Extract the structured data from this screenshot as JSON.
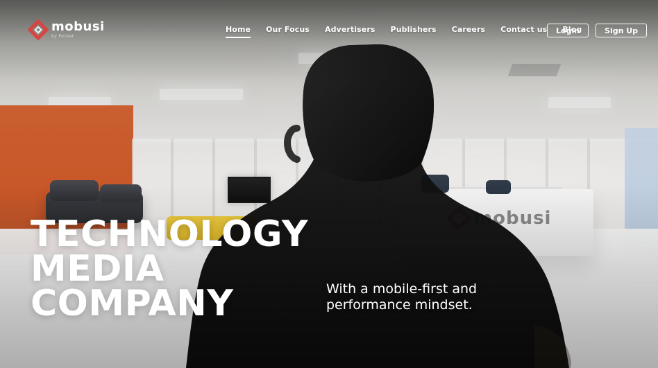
{
  "brand": {
    "name": "mobusi",
    "tagline": "by Pocket"
  },
  "nav": {
    "items": [
      {
        "label": "Home",
        "active": true
      },
      {
        "label": "Our Focus"
      },
      {
        "label": "Advertisers"
      },
      {
        "label": "Publishers"
      },
      {
        "label": "Careers"
      },
      {
        "label": "Contact us"
      },
      {
        "label": "Blog"
      }
    ]
  },
  "auth": {
    "login": "Login",
    "signup": "Sign Up"
  },
  "hero": {
    "headline": [
      "TECHNOLOGY",
      "MEDIA",
      "COMPANY"
    ],
    "subhead": "With a mobile-first and performance mindset.",
    "desk_logo_text": "mobusi"
  },
  "colors": {
    "accent": "#d6453f",
    "white": "#ffffff"
  }
}
